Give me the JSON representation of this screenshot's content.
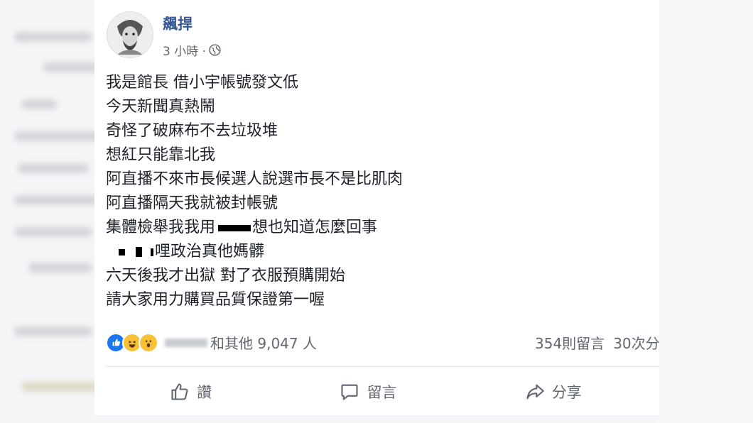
{
  "post": {
    "author": "飆捍",
    "time": "3 小時 ·",
    "lines": [
      "我是館長 借小宇帳號發文低",
      "今天新聞真熱鬧",
      "奇怪了破麻布不去垃圾堆",
      "想紅只能靠北我",
      "阿直播不來市長候選人說選市長不是比肌肉",
      "阿直播隔天我就被封帳號"
    ],
    "line7_a": "集體檢舉我我用",
    "line7_b": "想也知道怎麼回事",
    "line8_b": "哩政治真他媽髒",
    "line9": "六天後我才出獄 對了衣服預購開始",
    "line10": "請大家用力購買品質保證第一喔",
    "reactions_text": "和其他 9,047 人",
    "comments": "354則留言",
    "shares": "30次分"
  },
  "actions": {
    "like": "讚",
    "comment": "留言",
    "share": "分享"
  },
  "icons": [
    "globe-icon",
    "thumbs-up-icon",
    "comment-icon",
    "share-icon",
    "like-reaction-icon",
    "haha-reaction-icon",
    "wow-reaction-icon"
  ],
  "colors": {
    "author": "#365899",
    "like_blue": "#1877f2"
  }
}
